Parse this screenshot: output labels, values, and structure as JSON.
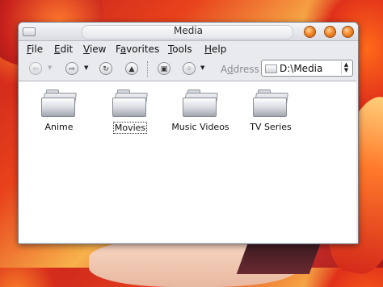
{
  "window": {
    "title": "Media"
  },
  "menubar": [
    {
      "accel": "F",
      "rest": "ile"
    },
    {
      "accel": "E",
      "rest": "dit"
    },
    {
      "accel": "V",
      "rest": "iew"
    },
    {
      "accel": "",
      "pre": "F",
      "rest": "avorites",
      "under": "a"
    },
    {
      "accel": "T",
      "rest": "ools"
    },
    {
      "accel": "H",
      "rest": "elp"
    }
  ],
  "menu_labels": {
    "file": {
      "u": "F",
      "t": "ile"
    },
    "edit": {
      "u": "E",
      "t": "dit"
    },
    "view": {
      "u": "V",
      "t": "iew"
    },
    "favorites_a": "F",
    "favorites_u": "a",
    "favorites_t": "vorites",
    "tools": {
      "u": "T",
      "t": "ools"
    },
    "help": {
      "u": "H",
      "t": "elp"
    }
  },
  "toolbar": {
    "back_glyph": "⇦",
    "forward_glyph": "⇨",
    "reload_glyph": "↻",
    "up_glyph": "▲",
    "view_glyph": "▣",
    "views_glyph": "⁘",
    "dropdown_glyph": "▼",
    "address_label_u": "d",
    "address_label_pre": "A",
    "address_label_rest": "dress",
    "address_value": "D:\\Media"
  },
  "folders": [
    {
      "name": "Anime",
      "focused": false
    },
    {
      "name": "Movies",
      "focused": true
    },
    {
      "name": "Music Videos",
      "focused": false
    },
    {
      "name": "TV Series",
      "focused": false
    }
  ]
}
